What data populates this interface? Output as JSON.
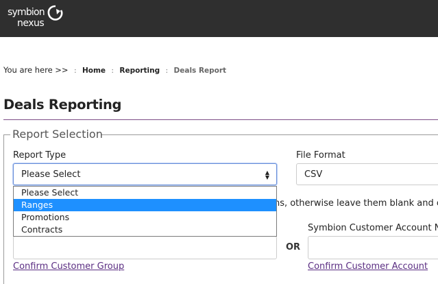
{
  "header": {
    "logo_line1": "symbion",
    "logo_line2": "nexus"
  },
  "breadcrumb": {
    "lead": "You are here >>",
    "items": [
      "Home",
      "Reporting",
      "Deals Report"
    ]
  },
  "page_title": "Deals Reporting",
  "report_selection": {
    "legend": "Report Selection",
    "report_type": {
      "label": "Report Type",
      "selected": "Please Select",
      "options": [
        "Please Select",
        "Ranges",
        "Promotions",
        "Contracts"
      ],
      "highlighted": "Ranges"
    },
    "file_format": {
      "label": "File Format",
      "value": "CSV"
    },
    "instruction_fragment": "ons, otherwise leave them blank and cli",
    "customer_account_label": "Symbion Customer Account Nu",
    "or_label": "OR",
    "confirm_group_link": "Confirm Customer Group",
    "confirm_account_link": "Confirm Customer Account"
  },
  "colors": {
    "topbar": "#2f2f2f",
    "accent_purple": "#7b4b86",
    "link": "#5a2d82",
    "highlight": "#1e90ff"
  }
}
